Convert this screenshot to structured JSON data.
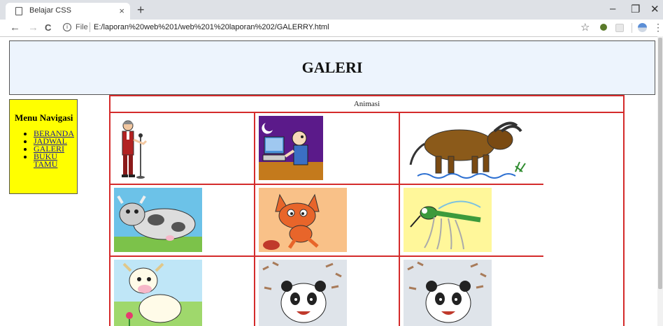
{
  "browser": {
    "tab_title": "Belajar CSS",
    "tab_close": "×",
    "new_tab": "+",
    "win_minimize": "–",
    "win_restore": "❐",
    "win_close": "✕",
    "nav_back": "←",
    "nav_forward": "→",
    "nav_reload": "C",
    "info_icon": "i",
    "file_label": "File",
    "url": "E:/laporan%20web%201/web%201%20laporan%202/GALERRY.html",
    "star": "☆",
    "menu": "⋮"
  },
  "page": {
    "title": "GALERI",
    "menu_title": "Menu Navigasi",
    "nav_items": [
      {
        "label": "BERANDA"
      },
      {
        "label": "JADWAL"
      },
      {
        "label": "GALERI"
      },
      {
        "label": "BUKU TAMU"
      }
    ],
    "gallery_caption": "Animasi",
    "images": [
      {
        "icon": "man-at-microphone"
      },
      {
        "icon": "person-at-computer"
      },
      {
        "icon": "water-buffalo"
      },
      {
        "icon": "cartoon-cow"
      },
      {
        "icon": "cartoon-fox"
      },
      {
        "icon": "mosquito"
      },
      {
        "icon": "cow-with-flower"
      },
      {
        "icon": "panda-with-money"
      },
      {
        "icon": "panda-with-money"
      }
    ]
  }
}
